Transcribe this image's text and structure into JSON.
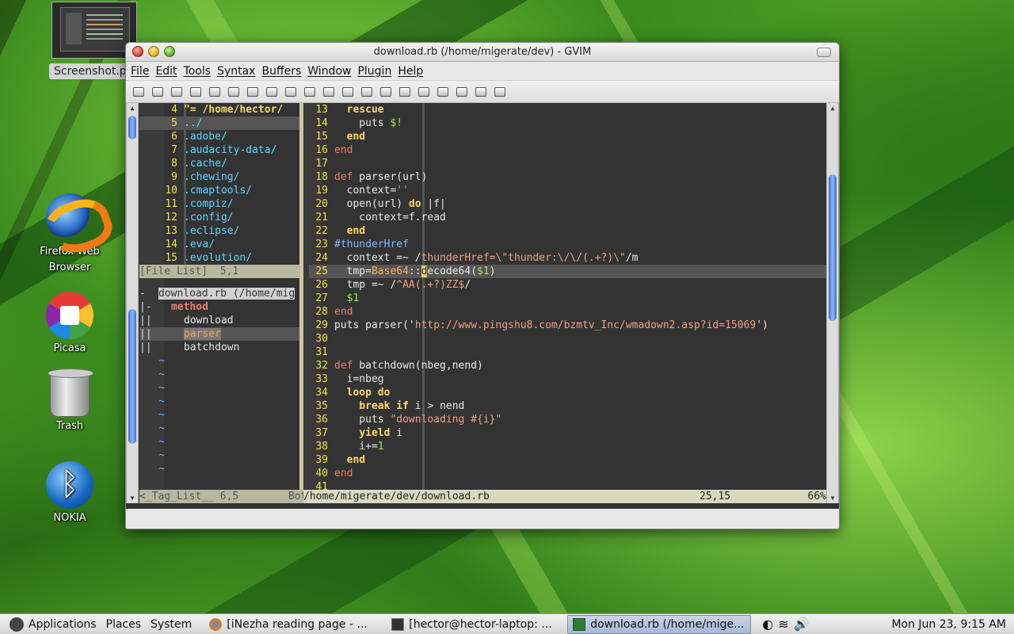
{
  "desktop": {
    "thumbnail_label": "Screenshot.p",
    "icons": [
      {
        "label": "Firefox Web Browser",
        "icon": "firefox-icon"
      },
      {
        "label": "Picasa",
        "icon": "picasa-icon"
      },
      {
        "label": "Trash",
        "icon": "trash-icon"
      },
      {
        "label": "NOKIA",
        "icon": "bluetooth-icon"
      }
    ]
  },
  "window": {
    "title": "download.rb (/home/migerate/dev) - GVIM",
    "menu": [
      "File",
      "Edit",
      "Tools",
      "Syntax",
      "Buffers",
      "Window",
      "Plugin",
      "Help"
    ],
    "toolbar_icons": [
      "open-icon",
      "save-icon",
      "save-all-icon",
      "print-icon",
      "undo-icon",
      "redo-icon",
      "cut-icon",
      "copy-icon",
      "paste-icon",
      "find-icon",
      "find-next-icon",
      "find-prev-icon",
      "load-session-icon",
      "save-session-icon",
      "run-script-icon",
      "make-icon",
      "shell-icon",
      "tags-icon",
      "help-icon",
      "find-help-icon"
    ]
  },
  "file_list": {
    "lines": [
      {
        "n": "4",
        "t": "\"= /home/hector/",
        "cls": "kw"
      },
      {
        "n": "5",
        "t": "../",
        "cls": "dir"
      },
      {
        "n": "6",
        "t": ".adobe/",
        "cls": "dir"
      },
      {
        "n": "7",
        "t": ".audacity-data/",
        "cls": "dir"
      },
      {
        "n": "8",
        "t": ".cache/",
        "cls": "dir"
      },
      {
        "n": "9",
        "t": ".chewing/",
        "cls": "dir"
      },
      {
        "n": "10",
        "t": ".cmaptools/",
        "cls": "dir"
      },
      {
        "n": "11",
        "t": ".compiz/",
        "cls": "dir"
      },
      {
        "n": "12",
        "t": ".config/",
        "cls": "dir"
      },
      {
        "n": "13",
        "t": ".eclipse/",
        "cls": "dir"
      },
      {
        "n": "14",
        "t": ".eva/",
        "cls": "dir"
      },
      {
        "n": "15",
        "t": ".evolution/",
        "cls": "dir"
      }
    ],
    "status": "[File List]  5,1           2%"
  },
  "tag_list": {
    "file": "download.rb (/home/mig",
    "group": "method",
    "items": [
      "download",
      "parser",
      "batchdown"
    ],
    "selected": "parser",
    "status": "<_Tag_List__ 6,5        Bot"
  },
  "code": {
    "lines": [
      {
        "n": "13",
        "h": "  <span class='kw'>rescue</span>"
      },
      {
        "n": "14",
        "h": "    puts <span class='num'>$!</span>"
      },
      {
        "n": "15",
        "h": "  <span class='kw'>end</span>"
      },
      {
        "n": "16",
        "h": "<span class='def'>end</span>"
      },
      {
        "n": "17",
        "h": ""
      },
      {
        "n": "18",
        "h": "<span class='def'>def</span> parser(url)"
      },
      {
        "n": "19",
        "h": "  context=<span class='str'>''</span>"
      },
      {
        "n": "20",
        "h": "  open(url) <span class='kw'>do</span> |f|"
      },
      {
        "n": "21",
        "h": "    context=f.read"
      },
      {
        "n": "22",
        "h": "  <span class='kw'>end</span>"
      },
      {
        "n": "23",
        "h": "<span class='cmt'>#thunderHref</span>"
      },
      {
        "n": "24",
        "h": "  context =~ /<span class='rx'>thunderHref=\\\"thunder:\\/\\/(.+?)\\\"</span>/m"
      },
      {
        "n": "25",
        "h": "  tmp=<span class='const'>Base64</span>::<span class='cursor'>d</span>ecode64(<span class='num'>$1</span>)",
        "cur": true
      },
      {
        "n": "26",
        "h": "  tmp =~ /<span class='rx'>^AA(.+?)ZZ$</span>/"
      },
      {
        "n": "27",
        "h": "  <span class='num'>$1</span>"
      },
      {
        "n": "28",
        "h": "<span class='def'>end</span>"
      },
      {
        "n": "29",
        "h": "puts parser('<span class='str'>http://www.pingshu8.com/bzmtv_Inc/wmadown2.asp?id=15069</span>')"
      },
      {
        "n": "30",
        "h": ""
      },
      {
        "n": "31",
        "h": ""
      },
      {
        "n": "32",
        "h": "<span class='def'>def</span> batchdown(nbeg,nend)"
      },
      {
        "n": "33",
        "h": "  i=nbeg"
      },
      {
        "n": "34",
        "h": "  <span class='kw'>loop</span> <span class='kw'>do</span>"
      },
      {
        "n": "35",
        "h": "    <span class='kw'>break</span> <span class='kw'>if</span> i &gt; nend"
      },
      {
        "n": "36",
        "h": "    puts <span class='str'>\"downloading #{i}\"</span>"
      },
      {
        "n": "37",
        "h": "    <span class='kw'>yield</span> i"
      },
      {
        "n": "38",
        "h": "    i+=<span class='num'>1</span>"
      },
      {
        "n": "39",
        "h": "  <span class='kw'>end</span>"
      },
      {
        "n": "40",
        "h": "<span class='def'>end</span>"
      },
      {
        "n": "41",
        "h": ""
      }
    ],
    "status_path": "/home/migerate/dev/download.rb",
    "status_pos": "25,15",
    "status_pct": "66%"
  },
  "taskbar": {
    "menus": [
      "Applications",
      "Places",
      "System"
    ],
    "tasks": [
      {
        "label": "[iNezha reading page - ...",
        "icon": "firefox-icon",
        "active": false
      },
      {
        "label": "[hector@hector-laptop: ...",
        "icon": "terminal-icon",
        "active": false
      },
      {
        "label": "download.rb (/home/mige...",
        "icon": "gvim-icon",
        "active": true
      }
    ],
    "clock": "Mon Jun 23,  9:15 AM"
  }
}
